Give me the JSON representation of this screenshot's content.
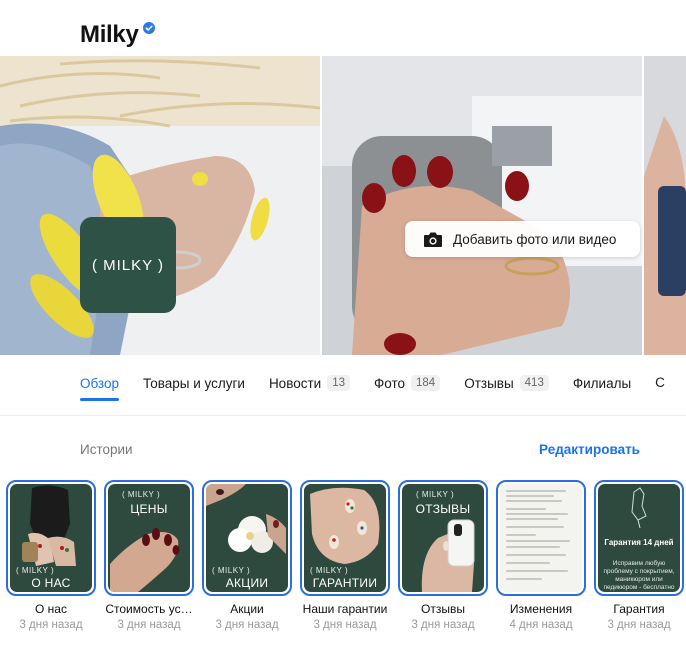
{
  "header": {
    "title": "Milky"
  },
  "gallery": {
    "logo_text": "( MILKY )",
    "add_media_label": "Добавить фото или видео"
  },
  "tabs": [
    {
      "label": "Обзор",
      "count": null,
      "active": true
    },
    {
      "label": "Товары и услуги",
      "count": null,
      "active": false
    },
    {
      "label": "Новости",
      "count": "13",
      "active": false
    },
    {
      "label": "Фото",
      "count": "184",
      "active": false
    },
    {
      "label": "Отзывы",
      "count": "413",
      "active": false
    },
    {
      "label": "Филиалы",
      "count": null,
      "active": false
    }
  ],
  "tabs_overflow_glyph": "С",
  "stories_section": {
    "label": "Истории",
    "edit_label": "Редактировать"
  },
  "stories": [
    {
      "name": "О нас",
      "time": "3 дня назад",
      "card_brand": "( MILKY )",
      "card_title": "О НАС"
    },
    {
      "name": "Стоимость ус…",
      "time": "3 дня назад",
      "card_brand": "( MILKY )",
      "card_title": "ЦЕНЫ"
    },
    {
      "name": "Акции",
      "time": "3 дня назад",
      "card_brand": "( MILKY )",
      "card_title": "АКЦИИ"
    },
    {
      "name": "Наши гарантии",
      "time": "3 дня назад",
      "card_brand": "( MILKY )",
      "card_title": "ГАРАНТИИ"
    },
    {
      "name": "Отзывы",
      "time": "3 дня назад",
      "card_brand": "( MILKY )",
      "card_title": "ОТЗЫВЫ"
    },
    {
      "name": "Изменения",
      "time": "4 дня назад"
    },
    {
      "name": "Гарантия",
      "time": "3 дня назад",
      "card_title": "Гарантия 14 дней",
      "card_text": "Исправим любую проблему с покрытием, маникюром или педикюром - бесплатно и без лишних вопросов❤"
    }
  ],
  "colors": {
    "accent": "#1a73e8",
    "story_ring": "#2a6fdb",
    "brand_green": "#2f5246"
  }
}
